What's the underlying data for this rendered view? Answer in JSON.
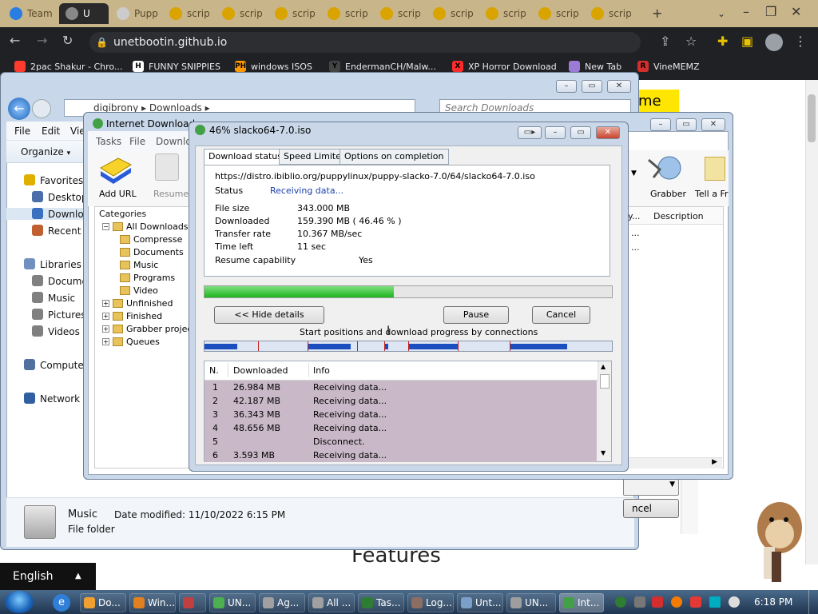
{
  "browser": {
    "tabs": [
      {
        "label": "Team",
        "color": "#2a7de1"
      },
      {
        "label": "U",
        "color": "#888888",
        "active": true
      },
      {
        "label": "Pupp",
        "color": "#cccccc"
      },
      {
        "label": "scrip",
        "color": "#d9a300"
      },
      {
        "label": "scrip",
        "color": "#d9a300"
      },
      {
        "label": "scrip",
        "color": "#d9a300"
      },
      {
        "label": "scrip",
        "color": "#d9a300"
      },
      {
        "label": "scrip",
        "color": "#d9a300"
      },
      {
        "label": "scrip",
        "color": "#d9a300"
      },
      {
        "label": "scrip",
        "color": "#d9a300"
      },
      {
        "label": "scrip",
        "color": "#d9a300"
      },
      {
        "label": "scrip",
        "color": "#d9a300"
      }
    ],
    "new_tab": "+",
    "url": "unetbootin.github.io",
    "bookmarks": [
      {
        "label": "2pac Shakur - Chro...",
        "color": "#ff3b30"
      },
      {
        "label": "FUNNY SNIPPIES",
        "color": "#ffffff",
        "glyph": "H"
      },
      {
        "label": "windows ISOS",
        "color": "#ff9900",
        "glyph": "PH"
      },
      {
        "label": "EndermanCH/Malw...",
        "color": "#444444",
        "glyph": "Y"
      },
      {
        "label": "XP Horror Download",
        "color": "#ff2a2a",
        "glyph": "X"
      },
      {
        "label": "New Tab",
        "color": "#9c7bd8"
      },
      {
        "label": "VineMEMZ",
        "color": "#d32f2f",
        "glyph": "R"
      }
    ]
  },
  "page": {
    "features_heading": "Features",
    "highlight_text": "ime",
    "language": "English"
  },
  "explorer": {
    "breadcrumb": [
      "digibrony",
      "Downloads"
    ],
    "search_placeholder": "Search Downloads",
    "menu": [
      "File",
      "Edit",
      "Vie"
    ],
    "organize": "Organize",
    "nav": [
      {
        "label": "Favorites",
        "color": "#e0b000"
      },
      {
        "label": "Desktop",
        "color": "#4a6fa8"
      },
      {
        "label": "Downlo",
        "color": "#3a70c0"
      },
      {
        "label": "Recent P",
        "color": "#c06030"
      },
      {
        "label": "Libraries",
        "color": "#7090c0"
      },
      {
        "label": "Docume",
        "color": "#808080"
      },
      {
        "label": "Music",
        "color": "#808080"
      },
      {
        "label": "Pictures",
        "color": "#808080"
      },
      {
        "label": "Videos",
        "color": "#808080"
      },
      {
        "label": "Computer",
        "color": "#5070a0"
      },
      {
        "label": "Network",
        "color": "#3060a0"
      }
    ],
    "status": {
      "name": "Music",
      "modified": "Date modified: 11/10/2022 6:15 PM",
      "type": "File folder"
    },
    "partial_button": "ncel"
  },
  "idm": {
    "title": "Internet Download",
    "menu": [
      "Tasks",
      "File",
      "Downlo"
    ],
    "toolbar": [
      {
        "label": "Add URL"
      },
      {
        "label": "Resume"
      },
      {
        "label": "Grabber"
      },
      {
        "label": "Tell a Fri"
      }
    ],
    "categories_title": "Categories",
    "categories": [
      {
        "label": "All Downloads",
        "level": 1
      },
      {
        "label": "Compresse",
        "level": 2
      },
      {
        "label": "Documents",
        "level": 2
      },
      {
        "label": "Music",
        "level": 2
      },
      {
        "label": "Programs",
        "level": 2
      },
      {
        "label": "Video",
        "level": 2
      },
      {
        "label": "Unfinished",
        "level": 1
      },
      {
        "label": "Finished",
        "level": 1
      },
      {
        "label": "Grabber projec",
        "level": 1
      },
      {
        "label": "Queues",
        "level": 1
      }
    ],
    "list_headers": [
      "y...",
      "Description"
    ],
    "list_rows": [
      "...",
      "..."
    ]
  },
  "download": {
    "title": "46% slacko64-7.0.iso",
    "tabs": [
      "Download status",
      "Speed Limiter",
      "Options on completion"
    ],
    "url": "https://distro.ibiblio.org/puppylinux/puppy-slacko-7.0/64/slacko64-7.0.iso",
    "status_label": "Status",
    "status_value": "Receiving data...",
    "fields": [
      {
        "label": "File size",
        "value": "343.000  MB"
      },
      {
        "label": "Downloaded",
        "value": "159.390  MB  ( 46.46 % )"
      },
      {
        "label": "Transfer rate",
        "value": "10.367  MB/sec"
      },
      {
        "label": "Time left",
        "value": "11 sec"
      }
    ],
    "resume_label": "Resume capability",
    "resume_value": "Yes",
    "progress": 0.4646,
    "buttons": {
      "hide": "<< Hide details",
      "pause": "Pause",
      "cancel": "Cancel"
    },
    "connections_caption": "Start positions and download progress by connections",
    "segments": [
      [
        0.0,
        0.08
      ],
      [
        0.252,
        0.358
      ],
      [
        0.442,
        0.452
      ],
      [
        0.5,
        0.622
      ],
      [
        0.749,
        0.891
      ]
    ],
    "ticks": [
      0.131,
      0.252,
      0.374,
      0.442,
      0.5,
      0.622,
      0.749
    ],
    "table_headers": [
      "N.",
      "Downloaded",
      "Info"
    ],
    "connections": [
      {
        "n": "1",
        "downloaded": "26.984  MB",
        "info": "Receiving data..."
      },
      {
        "n": "2",
        "downloaded": "42.187  MB",
        "info": "Receiving data..."
      },
      {
        "n": "3",
        "downloaded": "36.343  MB",
        "info": "Receiving data..."
      },
      {
        "n": "4",
        "downloaded": "48.656  MB",
        "info": "Receiving data..."
      },
      {
        "n": "5",
        "downloaded": "",
        "info": "Disconnect."
      },
      {
        "n": "6",
        "downloaded": "3.593  MB",
        "info": "Receiving data..."
      }
    ]
  },
  "taskbar": {
    "items": [
      {
        "label": "Do...",
        "color": "#f0a030"
      },
      {
        "label": "Win...",
        "color": "#e08020"
      },
      {
        "label": "",
        "color": "#c04040"
      },
      {
        "label": "UN...",
        "color": "#4caf50"
      },
      {
        "label": "Ag...",
        "color": "#a0a0a0"
      },
      {
        "label": "All ...",
        "color": "#a0a0a0"
      },
      {
        "label": "Tas...",
        "color": "#2e7d32"
      },
      {
        "label": "Log...",
        "color": "#8d6e63"
      },
      {
        "label": "Unt...",
        "color": "#7aa0c8"
      },
      {
        "label": "UN...",
        "color": "#9e9e9e"
      },
      {
        "label": "Int...",
        "color": "#43a047",
        "active": true
      }
    ],
    "clock": "6:18 PM"
  }
}
